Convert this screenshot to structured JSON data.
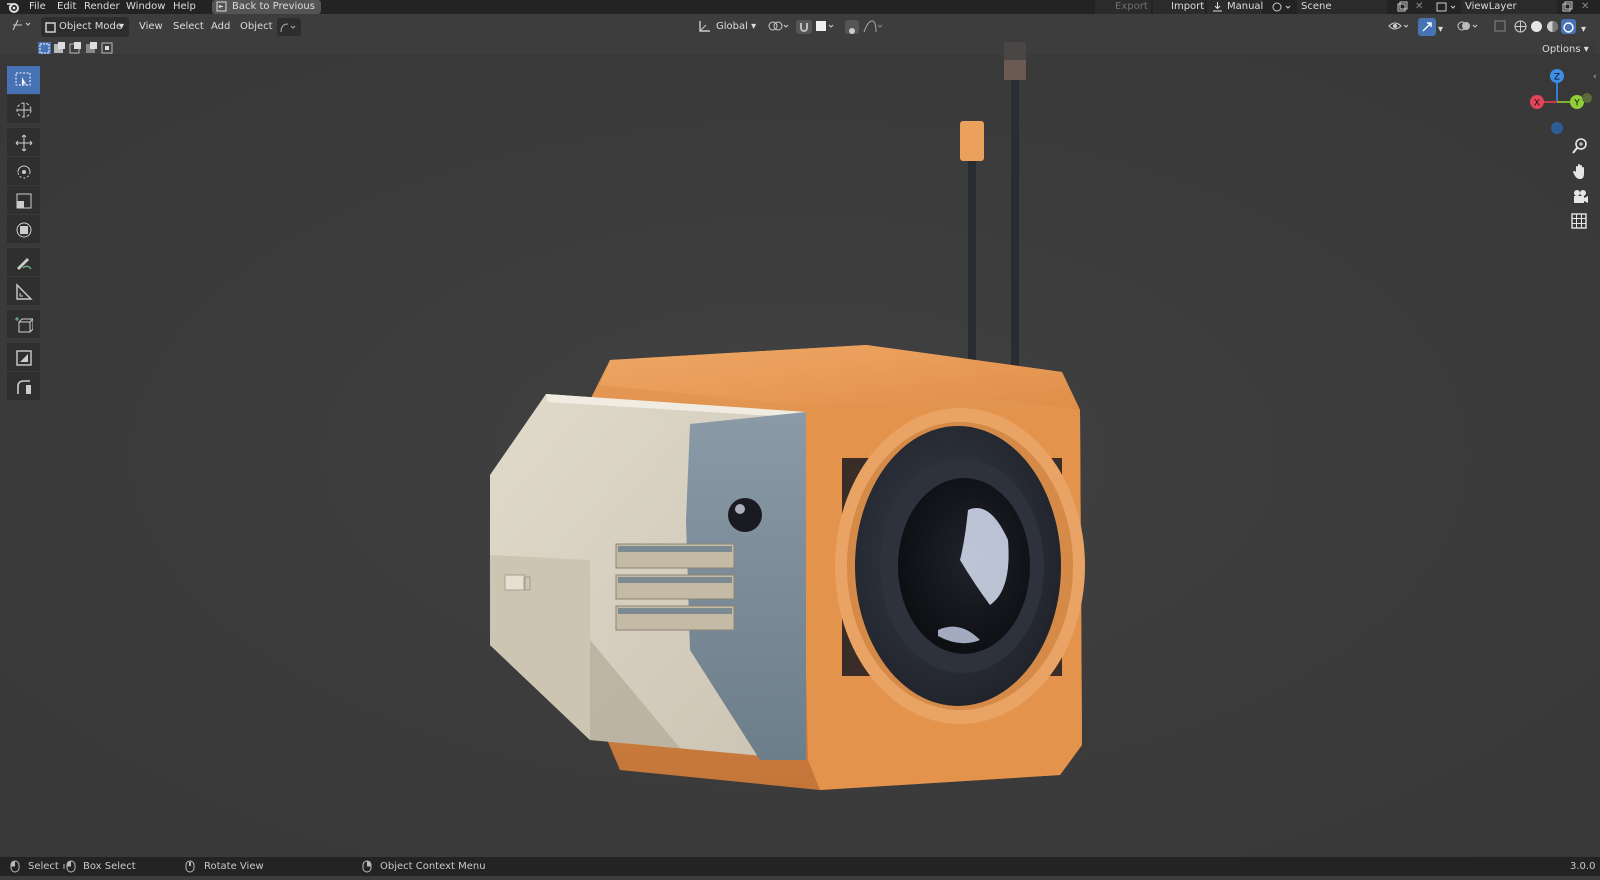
{
  "topbar": {
    "menu": [
      "File",
      "Edit",
      "Render",
      "Window",
      "Help"
    ],
    "back_button": "Back to Previous",
    "export": "Export",
    "import": "Import",
    "manual": "Manual",
    "scene": "Scene",
    "view_layer": "ViewLayer"
  },
  "header": {
    "mode": "Object Mode",
    "menus": [
      "View",
      "Select",
      "Add",
      "Object"
    ],
    "orientation": "Global",
    "options": "Options"
  },
  "gizmo": {
    "x": "X",
    "y": "Y",
    "z": "Z"
  },
  "statusbar": {
    "select": "Select",
    "box_select": "Box Select",
    "rotate_view": "Rotate View",
    "context_menu": "Object Context Menu",
    "version": "3.0.0"
  },
  "colors": {
    "accent": "#4772b3",
    "body_orange": "#e39852",
    "panel_cream": "#d8d2c4",
    "lens_dark": "#2a2d36"
  },
  "icons": [
    "blender-logo-icon",
    "select-box-icon",
    "cursor-icon",
    "move-icon",
    "rotate-icon",
    "scale-icon",
    "transform-icon",
    "annotate-icon",
    "measure-icon",
    "add-cube-icon",
    "inset-icon",
    "bevel-icon",
    "zoom-icon",
    "hand-icon",
    "camera-icon",
    "grid-icon"
  ]
}
